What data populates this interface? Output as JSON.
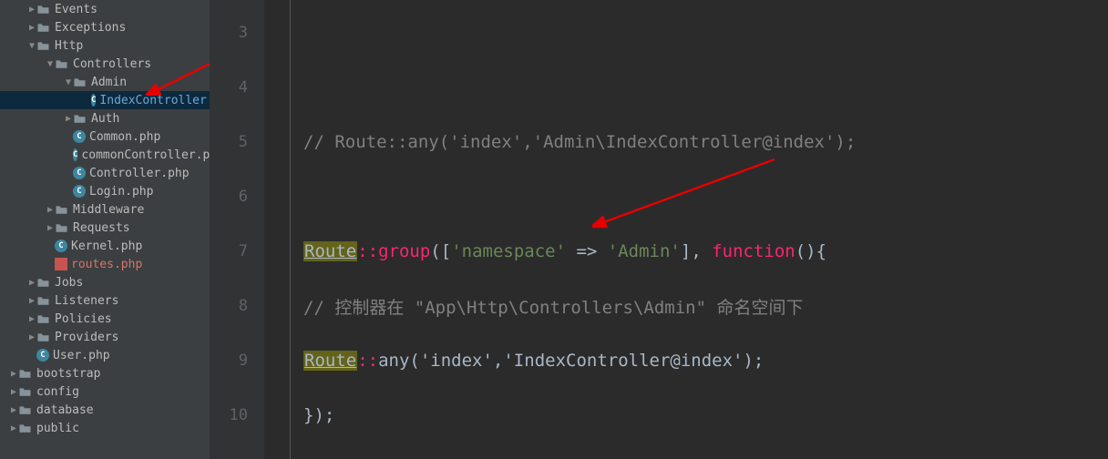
{
  "tree": {
    "events": "Events",
    "exceptions": "Exceptions",
    "http": "Http",
    "controllers": "Controllers",
    "admin": "Admin",
    "indexController": "IndexController.p",
    "auth": "Auth",
    "common": "Common.php",
    "commonController": "commonController.p",
    "controller": "Controller.php",
    "login": "Login.php",
    "middleware": "Middleware",
    "requests": "Requests",
    "kernel": "Kernel.php",
    "routes": "routes.php",
    "jobs": "Jobs",
    "listeners": "Listeners",
    "policies": "Policies",
    "providers": "Providers",
    "user": "User.php",
    "bootstrap": "bootstrap",
    "config": "config",
    "database": "database",
    "public": "public"
  },
  "gutter": {
    "l3": "3",
    "l4": "4",
    "l5": "5",
    "l6": "6",
    "l7": "7",
    "l8": "8",
    "l9": "9",
    "l10": "10"
  },
  "code": {
    "commentLine": "// Route::any('index','Admin\\IndexController@index');",
    "route": "Route",
    "dcolon": "::",
    "group": "group",
    "nsKey": "'namespace'",
    "arrow": " => ",
    "nsVal": "'Admin'",
    "funcOpen": "], ",
    "function": "function",
    "tail": "(){",
    "comment2": "// 控制器在 \"App\\Http\\Controllers\\Admin\" 命名空间下",
    "any": "any",
    "anyArgs": "('index','IndexController@index');",
    "close": "});",
    "open": "(["
  }
}
